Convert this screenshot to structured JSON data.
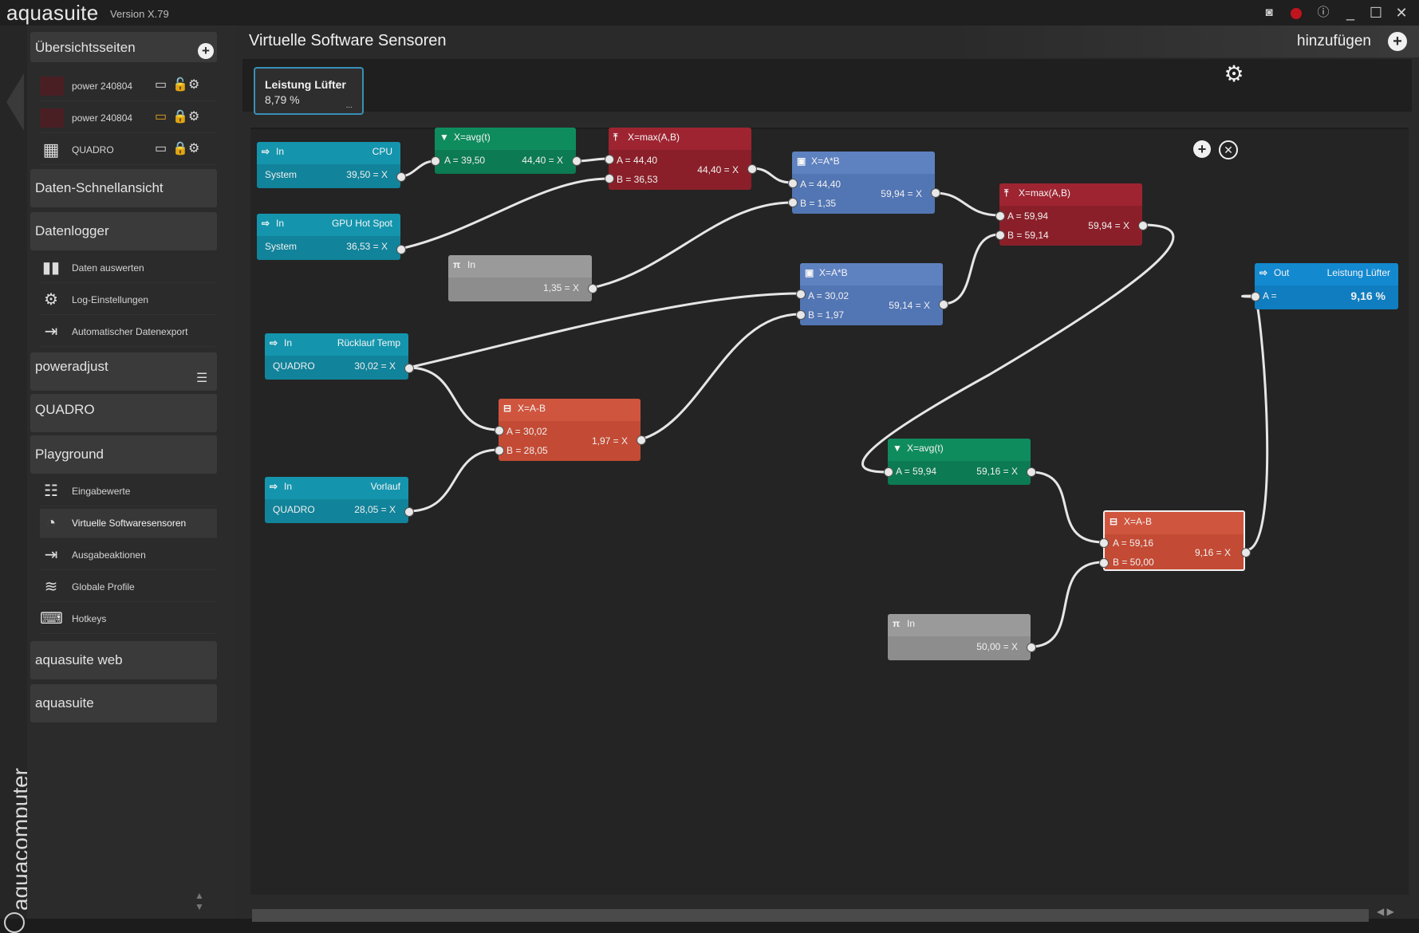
{
  "app": {
    "name": "aquasuite",
    "version": "Version X.79",
    "brand": "aquacomputer"
  },
  "sidebar": {
    "overview": {
      "title": "Übersichtsseiten",
      "pages": [
        {
          "label": "power 240804",
          "lock": "unlocked",
          "accent": "#e0a020"
        },
        {
          "label": "power 240804",
          "lock": "locked",
          "accent": "#e0a020"
        },
        {
          "label": "QUADRO",
          "lock": "locked",
          "accent": "#dcdcdc"
        }
      ]
    },
    "quick_view": "Daten-Schnellansicht",
    "datalogger": {
      "title": "Datenlogger",
      "items": [
        "Daten auswerten",
        "Log-Einstellungen",
        "Automatischer Datenexport"
      ]
    },
    "poweradjust": "poweradjust",
    "quadro": "QUADRO",
    "playground": {
      "title": "Playground",
      "items": [
        "Eingabewerte",
        "Virtuelle Softwaresensoren",
        "Ausgabeaktionen",
        "Globale Profile",
        "Hotkeys"
      ],
      "active_index": 1
    },
    "web": "aquasuite web",
    "suite": "aquasuite"
  },
  "main": {
    "title": "Virtuelle Software Sensoren",
    "add_label": "hinzufügen",
    "sensor_card": {
      "name": "Leistung Lüfter",
      "value": "8,79 %",
      "dots": "..."
    }
  },
  "nodes": {
    "in_cpu": {
      "title": "In",
      "source": "CPU",
      "sub": "System",
      "value": "39,50 = X"
    },
    "in_gpu": {
      "title": "In",
      "source": "GPU Hot Spot",
      "sub": "System",
      "value": "36,53 = X"
    },
    "in_ruecklauf": {
      "title": "In",
      "source": "Rücklauf Temp",
      "sub": "QUADRO",
      "value": "30,02 = X"
    },
    "in_vorlauf": {
      "title": "In",
      "source": "Vorlauf",
      "sub": "QUADRO",
      "value": "28,05 = X"
    },
    "const_1": {
      "title": "In",
      "value": "1,35 = X"
    },
    "const_2": {
      "title": "In",
      "value": "50,00 = X"
    },
    "avg_1": {
      "title": "X=avg(t)",
      "a": "A = 39,50",
      "out": "44,40 = X"
    },
    "max_1": {
      "title": "X=max(A,B)",
      "a": "A = 44,40",
      "b": "B = 36,53",
      "out": "44,40 = X"
    },
    "mul_1": {
      "title": "X=A*B",
      "a": "A = 44,40",
      "b": "B = 1,35",
      "out": "59,94 = X"
    },
    "max_2": {
      "title": "X=max(A,B)",
      "a": "A = 59,94",
      "b": "B = 59,14",
      "out": "59,94 = X"
    },
    "mul_2": {
      "title": "X=A*B",
      "a": "A = 30,02",
      "b": "B = 1,97",
      "out": "59,14 = X"
    },
    "sub_1": {
      "title": "X=A-B",
      "a": "A = 30,02",
      "b": "B = 28,05",
      "out": "1,97 = X"
    },
    "avg_2": {
      "title": "X=avg(t)",
      "a": "A = 59,94",
      "out": "59,16 = X"
    },
    "sub_2": {
      "title": "X=A-B",
      "a": "A = 59,16",
      "b": "B = 50,00",
      "out": "9,16 = X"
    },
    "out_1": {
      "title": "Out",
      "target": "Leistung Lüfter",
      "a": "A =",
      "value": "9,16 %"
    }
  },
  "icons": {
    "in": "sign-in-icon",
    "out": "sign-out-icon",
    "const": "pi-icon",
    "avg": "filter-icon",
    "max": "max-arrow-icon",
    "mul": "multiply-icon",
    "sub": "minus-icon",
    "settings": "gear-icon",
    "add": "plus-circle-icon",
    "close": "close-circle-icon"
  },
  "colors": {
    "input": "#1495ad",
    "avg": "#0f8c5e",
    "max": "#9e2431",
    "mul": "#5e81c0",
    "sub": "#d0553e",
    "const": "#9a9a9a",
    "output": "#1389d0",
    "highlight": "#3a8fb8"
  }
}
